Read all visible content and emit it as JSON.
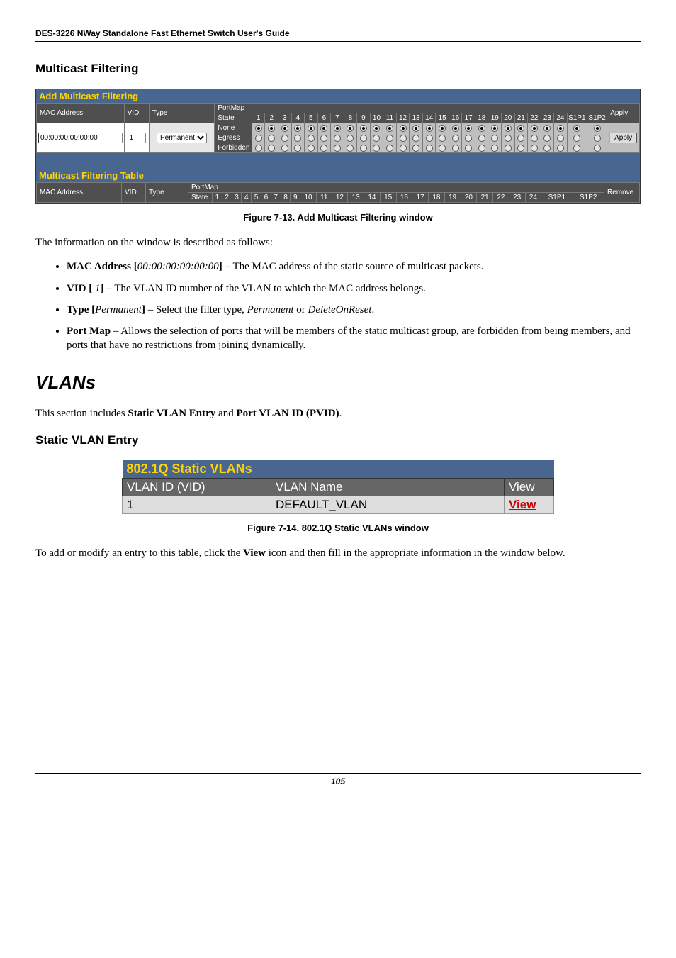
{
  "header": "DES-3226 NWay Standalone Fast Ethernet Switch User's Guide",
  "section1_title": "Multicast Filtering",
  "mcast_panel_title": "Add Multicast Filtering",
  "mcast_headers": {
    "mac": "MAC Address",
    "vid": "VID",
    "type": "Type",
    "portmap": "PortMap",
    "state": "State",
    "apply": "Apply"
  },
  "mcast_cols": [
    "1",
    "2",
    "3",
    "4",
    "5",
    "6",
    "7",
    "8",
    "9",
    "10",
    "11",
    "12",
    "13",
    "14",
    "15",
    "16",
    "17",
    "18",
    "19",
    "20",
    "21",
    "22",
    "23",
    "24",
    "S1P1",
    "S1P2"
  ],
  "mcast_states": [
    "None",
    "Egress",
    "Forbidden"
  ],
  "mcast_row": {
    "mac_value": "00:00:00:00:00:00",
    "vid_value": "1",
    "type_value": "Permanent"
  },
  "mcast_apply_button": "Apply",
  "filter_table_title": "Multicast Filtering Table",
  "filter_headers": {
    "mac": "MAC Address",
    "vid": "VID",
    "type": "Type",
    "portmap": "PortMap",
    "state": "State",
    "remove": "Remove"
  },
  "figure713": "Figure 7-13.  Add Multicast Filtering window",
  "para_intro": "The information on the window is described as follows:",
  "bullet1_strong": "MAC Address [",
  "bullet1_ital": "00:00:00:00:00:00",
  "bullet1_strong2": "]",
  "bullet1_after": " – The MAC address of the static source of multicast packets.",
  "bullet2_strong": "VID [",
  "bullet2_ital": " 1",
  "bullet2_strong2": "]",
  "bullet2_after": " – The VLAN ID number of the VLAN to which the MAC address belongs.",
  "bullet3_strong": "Type [",
  "bullet3_ital": "Permanent",
  "bullet3_strong2": "]",
  "bullet3_after_a": " – Select the filter type, ",
  "bullet3_after_i1": "Permanent",
  "bullet3_after_mid": " or ",
  "bullet3_after_i2": "DeleteOnReset",
  "bullet3_after_end": ".",
  "bullet4_strong": "Port Map",
  "bullet4_after": " – Allows the selection of ports that will be members of the static multicast group, are forbidden from being members, and ports that have no restrictions from joining dynamically.",
  "vlans_heading": "VLANs",
  "vlans_intro_a": "This section includes ",
  "vlans_intro_b": "Static VLAN Entry",
  "vlans_intro_c": " and ",
  "vlans_intro_d": "Port VLAN ID (PVID)",
  "vlans_intro_e": ".",
  "static_vlan_heading": "Static VLAN Entry",
  "vlan_panel": {
    "title": "802.1Q Static VLANs",
    "col1": "VLAN ID (VID)",
    "col2": "VLAN Name",
    "col3": "View",
    "row_id": "1",
    "row_name": "DEFAULT_VLAN",
    "row_view": "View"
  },
  "figure714": "Figure 7-14.  802.1Q Static VLANs window",
  "final_a": "To add or modify an entry to this table, click the ",
  "final_b": "View",
  "final_c": " icon and then fill in the appropriate information in the window below.",
  "page_number": "105"
}
